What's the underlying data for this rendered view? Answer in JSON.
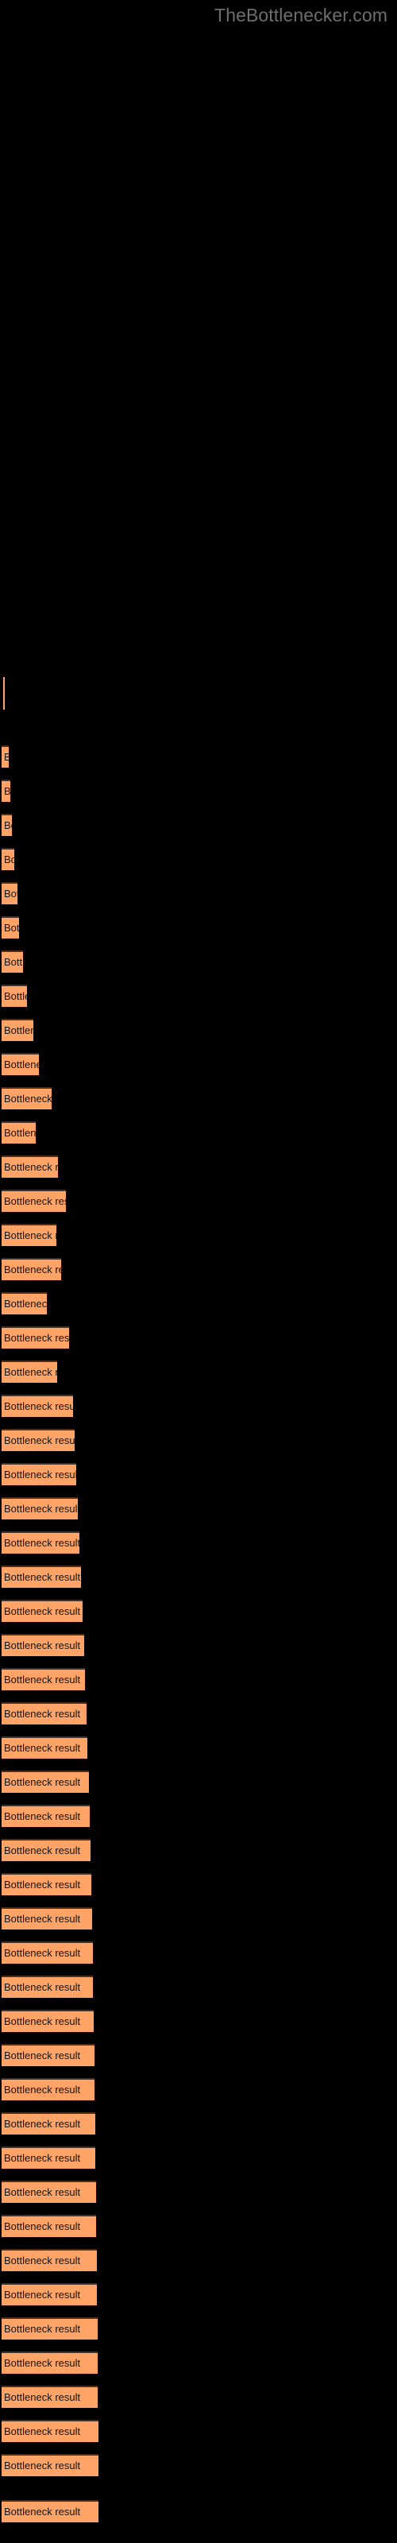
{
  "site": {
    "title": "TheBottlenecker.com",
    "title_color": "#6e6e6e"
  },
  "theme": {
    "background": "#000000",
    "bar_fill": "#ffa366",
    "bar_border_top": "#4a3020",
    "bar_label_color": "#141414"
  },
  "chart_data": {
    "type": "bar",
    "orientation": "horizontal",
    "title": "",
    "subtitle": "",
    "xlabel": "",
    "ylabel": "",
    "grid": false,
    "legend": null,
    "bar_label_text": "Bottleneck result",
    "xlim": [
      0,
      500
    ],
    "note": "Each bar is labelled 'Bottleneck result'; the label text is clipped to the bar width so shorter bars show only a prefix.",
    "categories": [
      "Bottleneck result",
      "Bottleneck result",
      "Bottleneck result",
      "Bottleneck result",
      "Bottleneck result",
      "Bottleneck result",
      "Bottleneck result",
      "Bottleneck result",
      "Bottleneck result",
      "Bottleneck result",
      "Bottleneck result",
      "Bottleneck result",
      "Bottleneck result",
      "Bottleneck result",
      "Bottleneck result",
      "Bottleneck result",
      "Bottleneck result",
      "Bottleneck result",
      "Bottleneck result",
      "Bottleneck result",
      "Bottleneck result",
      "Bottleneck result",
      "Bottleneck result",
      "Bottleneck result",
      "Bottleneck result",
      "Bottleneck result",
      "Bottleneck result"
    ],
    "values": [
      2,
      9,
      11,
      13,
      16,
      20,
      32,
      43,
      40,
      53,
      62,
      54,
      64,
      72,
      66,
      78,
      80,
      82,
      84,
      88,
      90,
      92,
      94,
      96,
      100,
      104,
      110
    ],
    "visible_labels": [
      "",
      "",
      "Bo",
      "B",
      "Bo",
      "Bottlen",
      "Bottleneck r",
      "Bottlene",
      "Bottleneck re",
      "Bottleneck resul",
      "Bottleneck re",
      "Bottleneck res",
      "Bottleneck",
      "Bottleneck result",
      "Bottleneck res",
      "Bottleneck result",
      "Bottleneck result",
      "Bottleneck result",
      "Bottleneck result",
      "Bottleneck result",
      "Bottleneck result",
      "Bottleneck result",
      "Bottleneck result",
      "Bottleneck result",
      "Bottleneck result",
      "Bottleneck result",
      "Bottleneck result"
    ],
    "bars": [
      {
        "top": 852,
        "height": 41,
        "width": 2,
        "label": "",
        "hairline": true
      },
      {
        "top": 938,
        "height": 28,
        "width": 9,
        "label": "",
        "hairline": false
      },
      {
        "top": 981,
        "height": 28,
        "width": 11,
        "label": "",
        "hairline": false
      },
      {
        "top": 1024,
        "height": 28,
        "width": 13,
        "label": "B",
        "hairline": false
      },
      {
        "top": 1067,
        "height": 28,
        "width": 16,
        "label": "Bo",
        "hairline": false
      },
      {
        "top": 1110,
        "height": 28,
        "width": 20,
        "label": "B",
        "hairline": false
      },
      {
        "top": 1153,
        "height": 28,
        "width": 22,
        "label": "Bo",
        "hairline": false
      },
      {
        "top": 1196,
        "height": 28,
        "width": 27,
        "label": "Bo",
        "hairline": false
      },
      {
        "top": 1239,
        "height": 28,
        "width": 32,
        "label": "Bo",
        "hairline": false
      },
      {
        "top": 1282,
        "height": 28,
        "width": 40,
        "label": "Bottlen",
        "hairline": false
      },
      {
        "top": 1325,
        "height": 28,
        "width": 47,
        "label": "Bottlen",
        "hairline": false
      },
      {
        "top": 1368,
        "height": 28,
        "width": 63,
        "label": "Bottleneck r",
        "hairline": false
      },
      {
        "top": 1411,
        "height": 28,
        "width": 43,
        "label": "Bottlene",
        "hairline": false
      },
      {
        "top": 1454,
        "height": 28,
        "width": 71,
        "label": "Bottleneck re",
        "hairline": false
      },
      {
        "top": 1497,
        "height": 28,
        "width": 81,
        "label": "Bottleneck resul",
        "hairline": false
      },
      {
        "top": 1540,
        "height": 28,
        "width": 69,
        "label": "Bottleneck re",
        "hairline": false
      },
      {
        "top": 1583,
        "height": 28,
        "width": 75,
        "label": "Bottleneck res",
        "hairline": false
      },
      {
        "top": 1626,
        "height": 28,
        "width": 57,
        "label": "Bottleneck",
        "hairline": false
      },
      {
        "top": 1669,
        "height": 28,
        "width": 85,
        "label": "Bottleneck result",
        "hairline": false
      },
      {
        "top": 1712,
        "height": 28,
        "width": 70,
        "label": "Bottleneck res",
        "hairline": false
      },
      {
        "top": 1755,
        "height": 28,
        "width": 90,
        "label": "Bottleneck result",
        "hairline": false
      },
      {
        "top": 1798,
        "height": 28,
        "width": 92,
        "label": "Bottleneck result",
        "hairline": false
      },
      {
        "top": 1841,
        "height": 28,
        "width": 94,
        "label": "Bottleneck result",
        "hairline": false
      },
      {
        "top": 1884,
        "height": 28,
        "width": 96,
        "label": "Bottleneck result",
        "hairline": false
      },
      {
        "top": 1927,
        "height": 28,
        "width": 98,
        "label": "Bottleneck result",
        "hairline": false
      },
      {
        "top": 1970,
        "height": 28,
        "width": 100,
        "label": "Bottleneck result",
        "hairline": false
      },
      {
        "top": 2013,
        "height": 28,
        "width": 102,
        "label": "Bottleneck result",
        "hairline": false
      },
      {
        "top": 2056,
        "height": 28,
        "width": 104,
        "label": "Bottleneck result",
        "hairline": false
      },
      {
        "top": 2099,
        "height": 28,
        "width": 105,
        "label": "Bottleneck result",
        "hairline": false
      },
      {
        "top": 2142,
        "height": 28,
        "width": 107,
        "label": "Bottleneck result",
        "hairline": false
      },
      {
        "top": 2185,
        "height": 28,
        "width": 108,
        "label": "Bottleneck result",
        "hairline": false
      },
      {
        "top": 2228,
        "height": 28,
        "width": 110,
        "label": "Bottleneck result",
        "hairline": false
      },
      {
        "top": 2271,
        "height": 28,
        "width": 111,
        "label": "Bottleneck result",
        "hairline": false
      },
      {
        "top": 2314,
        "height": 28,
        "width": 112,
        "label": "Bottleneck result",
        "hairline": false
      },
      {
        "top": 2357,
        "height": 28,
        "width": 113,
        "label": "Bottleneck result",
        "hairline": false
      },
      {
        "top": 2400,
        "height": 28,
        "width": 114,
        "label": "Bottleneck result",
        "hairline": false
      },
      {
        "top": 2443,
        "height": 28,
        "width": 115,
        "label": "Bottleneck result",
        "hairline": false
      },
      {
        "top": 2486,
        "height": 28,
        "width": 115,
        "label": "Bottleneck result",
        "hairline": false
      },
      {
        "top": 2529,
        "height": 28,
        "width": 116,
        "label": "Bottleneck result",
        "hairline": false
      },
      {
        "top": 2572,
        "height": 28,
        "width": 117,
        "label": "Bottleneck result",
        "hairline": false
      },
      {
        "top": 2615,
        "height": 28,
        "width": 117,
        "label": "Bottleneck result",
        "hairline": false
      },
      {
        "top": 2658,
        "height": 28,
        "width": 118,
        "label": "Bottleneck result",
        "hairline": false
      },
      {
        "top": 2701,
        "height": 28,
        "width": 118,
        "label": "Bottleneck result",
        "hairline": false
      },
      {
        "top": 2744,
        "height": 28,
        "width": 119,
        "label": "Bottleneck result",
        "hairline": false
      },
      {
        "top": 2787,
        "height": 28,
        "width": 119,
        "label": "Bottleneck result",
        "hairline": false
      },
      {
        "top": 2830,
        "height": 28,
        "width": 120,
        "label": "Bottleneck result",
        "hairline": false
      },
      {
        "top": 2873,
        "height": 28,
        "width": 120,
        "label": "Bottleneck result",
        "hairline": false
      },
      {
        "top": 2916,
        "height": 28,
        "width": 121,
        "label": "Bottleneck result",
        "hairline": false
      },
      {
        "top": 2959,
        "height": 28,
        "width": 121,
        "label": "Bottleneck result",
        "hairline": false
      },
      {
        "top": 3002,
        "height": 28,
        "width": 121,
        "label": "Bottleneck result",
        "hairline": false
      },
      {
        "top": 3045,
        "height": 28,
        "width": 122,
        "label": "Bottleneck result",
        "hairline": false
      },
      {
        "top": 3088,
        "height": 28,
        "width": 122,
        "label": "Bottleneck result",
        "hairline": false
      },
      {
        "top": 3146,
        "height": 28,
        "width": 122,
        "label": "Bottleneck result",
        "hairline": false
      }
    ]
  }
}
